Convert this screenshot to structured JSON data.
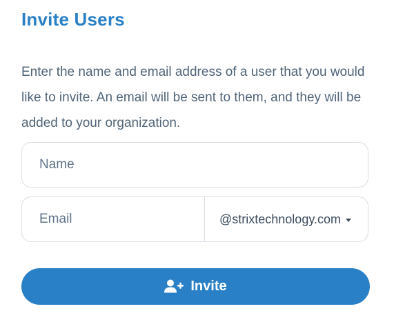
{
  "header": {
    "title": "Invite Users"
  },
  "description": "Enter the name and email address of a user that you would like to invite. An email will be sent to them, and they will be added to your organization.",
  "form": {
    "name": {
      "placeholder": "Name",
      "value": ""
    },
    "email": {
      "placeholder": "Email",
      "value": ""
    },
    "domain": {
      "selected": "@strixtechnology.com",
      "icon": "chevron-down-icon"
    }
  },
  "invite_button": {
    "label": "Invite",
    "icon": "user-plus-icon"
  },
  "colors": {
    "accent": "#2a80c6",
    "text": "#506478",
    "border": "#d9dee4"
  }
}
